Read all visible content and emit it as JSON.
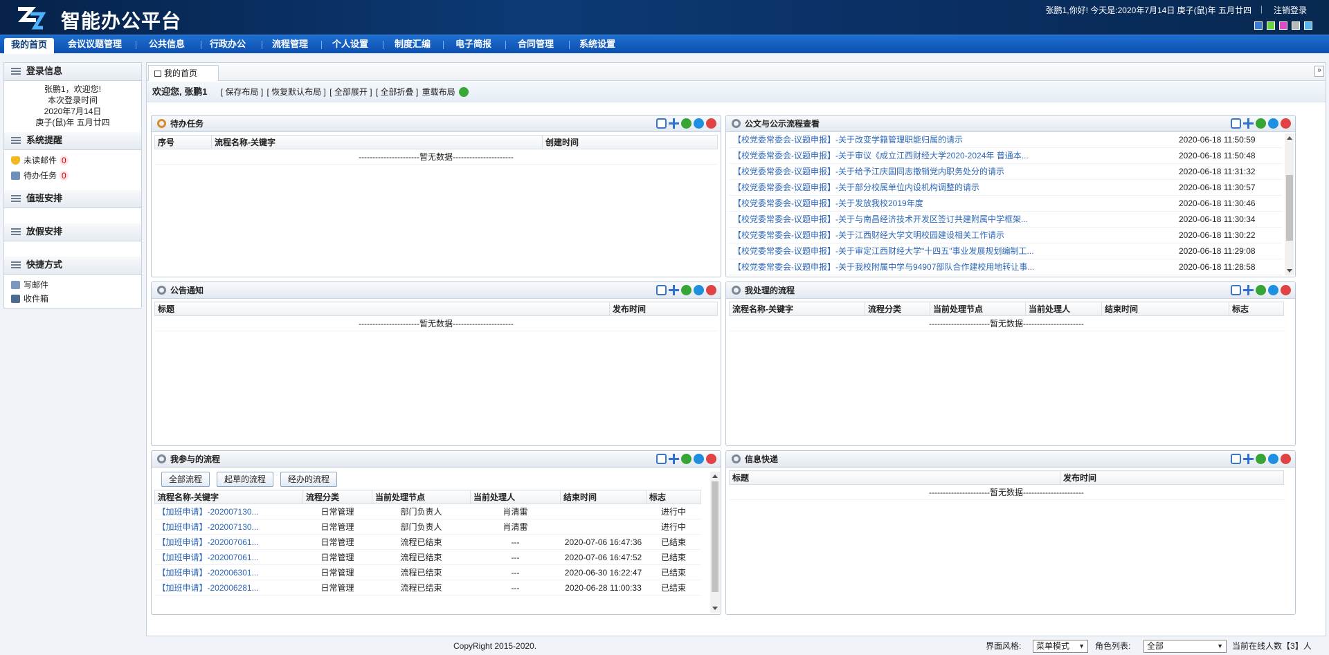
{
  "header": {
    "title": "智能办公平台",
    "greeting": "张鹏1,你好! 今天是:2020年7月14日 庚子(鼠)年 五月廿四",
    "logout": "注销登录",
    "theme_colors": [
      "#3d7bd8",
      "#6bd33c",
      "#e548c9",
      "#b9b9b9",
      "#58b6f2"
    ]
  },
  "nav": {
    "items": [
      "我的首页",
      "会议议题管理",
      "公共信息",
      "行政办公",
      "流程管理",
      "个人设置",
      "制度汇编",
      "电子简报",
      "合同管理",
      "系统设置"
    ]
  },
  "sidebar": {
    "login": {
      "title": "登录信息",
      "name_line": "张鹏1，欢迎您!",
      "label_line": "本次登录时间",
      "date_line": "2020年7月14日",
      "lunar_line": "庚子(鼠)年 五月廿四"
    },
    "reminder": {
      "title": "系统提醒",
      "unread_label": "未读邮件",
      "unread_count": "0",
      "todo_label": "待办任务",
      "todo_count": "0"
    },
    "duty_title": "值班安排",
    "holiday_title": "放假安排",
    "shortcut": {
      "title": "快捷方式",
      "write_mail": "写邮件",
      "inbox": "收件箱"
    }
  },
  "main": {
    "tab": "我的首页",
    "welcome": "欢迎您, 张鹏1",
    "links": [
      "[ 保存布局 ]",
      "[ 恢复默认布局 ]",
      "[ 全部展开 ]",
      "[ 全部折叠 ]",
      "重载布局"
    ]
  },
  "panels": {
    "todo": {
      "title": "待办任务",
      "cols": [
        "序号",
        "流程名称-关键字",
        "创建时间"
      ],
      "empty": "----------------------暂无数据----------------------"
    },
    "docs": {
      "title": "公文与公示流程查看",
      "rows": [
        {
          "title": "【校党委常委会-议题申报】-关于改变学籍管理职能归属的请示",
          "time": "2020-06-18 11:50:59"
        },
        {
          "title": "【校党委常委会-议题申报】-关于审议《成立江西财经大学2020-2024年 普通本...",
          "time": "2020-06-18 11:50:48"
        },
        {
          "title": "【校党委常委会-议题申报】-关于给予江庆国同志撤销党内职务处分的请示",
          "time": "2020-06-18 11:31:32"
        },
        {
          "title": "【校党委常委会-议题申报】-关于部分校属单位内设机构调整的请示",
          "time": "2020-06-18 11:30:57"
        },
        {
          "title": "【校党委常委会-议题申报】-关于发放我校2019年度",
          "time": "2020-06-18 11:30:46"
        },
        {
          "title": "【校党委常委会-议题申报】-关于与南昌经济技术开发区签订共建附属中学框架...",
          "time": "2020-06-18 11:30:34"
        },
        {
          "title": "【校党委常委会-议题申报】-关于江西财经大学文明校园建设相关工作请示",
          "time": "2020-06-18 11:30:22"
        },
        {
          "title": "【校党委常委会-议题申报】-关于审定江西财经大学\"十四五\"事业发展规划编制工...",
          "time": "2020-06-18 11:29:08"
        },
        {
          "title": "【校党委常委会-议题申报】-关于我校附属中学与94907部队合作建校用地转让事...",
          "time": "2020-06-18 11:28:58"
        }
      ]
    },
    "notice": {
      "title": "公告通知",
      "cols": [
        "标题",
        "发布时间"
      ],
      "empty": "----------------------暂无数据----------------------"
    },
    "handled": {
      "title": "我处理的流程",
      "cols": [
        "流程名称-关键字",
        "流程分类",
        "当前处理节点",
        "当前处理人",
        "结束时间",
        "标志"
      ],
      "empty": "----------------------暂无数据----------------------"
    },
    "involved": {
      "title": "我参与的流程",
      "buttons": [
        "全部流程",
        "起草的流程",
        "经办的流程"
      ],
      "cols": [
        "流程名称-关键字",
        "流程分类",
        "当前处理节点",
        "当前处理人",
        "结束时间",
        "标志"
      ],
      "rows": [
        [
          "【加班申请】-202007130...",
          "日常管理",
          "部门负责人",
          "肖清雷",
          "",
          "进行中"
        ],
        [
          "【加班申请】-202007130...",
          "日常管理",
          "部门负责人",
          "肖清雷",
          "",
          "进行中"
        ],
        [
          "【加班申请】-202007061...",
          "日常管理",
          "流程已结束",
          "---",
          "2020-07-06 16:47:36",
          "已结束"
        ],
        [
          "【加班申请】-202007061...",
          "日常管理",
          "流程已结束",
          "---",
          "2020-07-06 16:47:52",
          "已结束"
        ],
        [
          "【加班申请】-202006301...",
          "日常管理",
          "流程已结束",
          "---",
          "2020-06-30 16:22:47",
          "已结束"
        ],
        [
          "【加班申请】-202006281...",
          "日常管理",
          "流程已结束",
          "---",
          "2020-06-28 11:00:33",
          "已结束"
        ]
      ]
    },
    "news": {
      "title": "信息快递",
      "cols": [
        "标题",
        "发布时间"
      ],
      "empty": "----------------------暂无数据----------------------"
    }
  },
  "footer": {
    "copyright": "CopyRight 2015-2020.",
    "style_label": "界面风格:",
    "style_value": "菜单模式",
    "role_label": "角色列表:",
    "role_value": "全部",
    "online_prefix": "当前在线人数【",
    "online_count": "3",
    "online_suffix": "】人"
  }
}
